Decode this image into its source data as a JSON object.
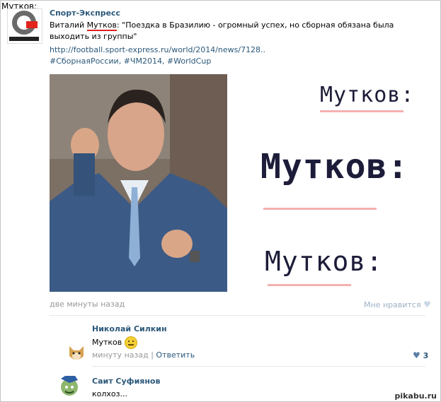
{
  "corner_label": "Мутков:",
  "post": {
    "author": "Спорт-Экспресс",
    "text_before": "Виталий ",
    "highlight": "Мутков",
    "text_after": ": \"Поездка в Бразилию - огромный успех, но сборная обязана была выходить из группы\"",
    "link": "http://football.sport-express.ru/world/2014/news/7128..",
    "hashtags": "#СборнаяРоссии, #ЧМ2014, #WorldCup",
    "time": "две минуты назад",
    "like_label": "Мне нравится"
  },
  "overlay_words": [
    "Мутков:",
    "Мутков:",
    "Мутков:"
  ],
  "comments": [
    {
      "author": "Николай Силкин",
      "text": "Мутков",
      "time": "минуту назад",
      "reply": "Ответить",
      "likes": "3"
    },
    {
      "author": "Саит Суфиянов",
      "text": "колхоз..."
    }
  ],
  "watermark": "pikabu.ru",
  "colors": {
    "link": "#2b587a",
    "highlight": "#dd2222",
    "muted": "#999999"
  },
  "icons": [
    "heart-icon",
    "smile-emoji-icon",
    "dog-avatar",
    "cat-avatar"
  ]
}
